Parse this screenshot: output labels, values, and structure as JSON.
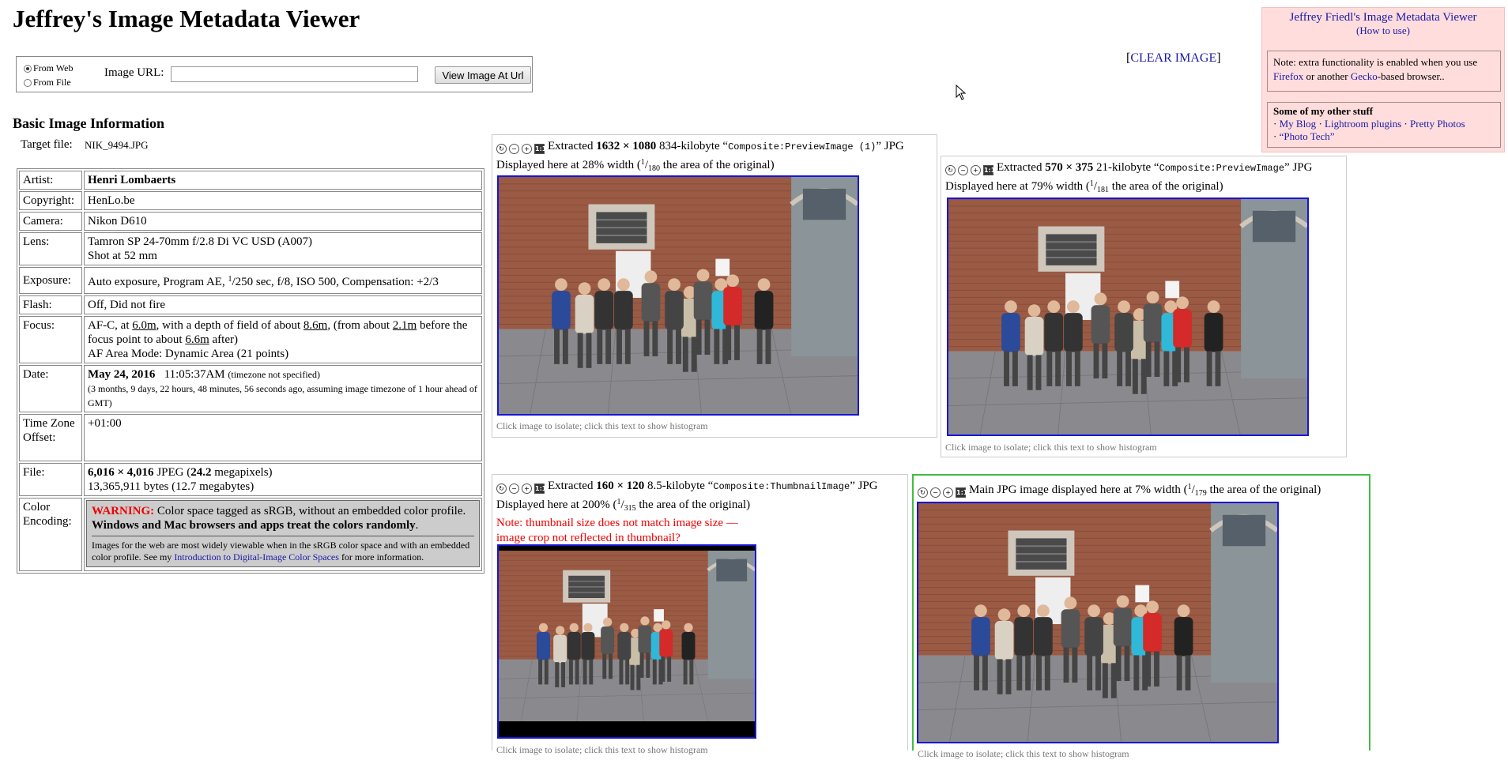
{
  "page": {
    "title": "Jeffrey's Image Metadata Viewer"
  },
  "form": {
    "from_web_label": "From Web",
    "from_file_label": "From File",
    "url_label": "Image URL:",
    "url_value": "",
    "view_button": "View Image At Url"
  },
  "clear": {
    "open": "[",
    "link": "CLEAR IMAGE",
    "close": "]"
  },
  "side": {
    "title": "Jeffrey Friedl's Image Metadata Viewer",
    "how_to_use": "(How to use)",
    "note_prefix": "Note: extra functionality is enabled when you use",
    "firefox": "Firefox",
    "note_mid": "or another",
    "gecko": "Gecko",
    "note_suffix": "-based browser..",
    "other_title": "Some of my other stuff",
    "links": [
      "My Blog",
      "Lightroom plugins",
      "Pretty Photos",
      "“Photo Tech”"
    ],
    "sep": "·"
  },
  "basic": {
    "heading": "Basic Image Information",
    "target_label": "Target file:",
    "target_value": "NIK_9494.JPG"
  },
  "info": {
    "artist_k": "Artist:",
    "artist_v": "Henri Lombaerts",
    "copyright_k": "Copyright:",
    "copyright_v": "HenLo.be",
    "camera_k": "Camera:",
    "camera_v": "Nikon D610",
    "lens_k": "Lens:",
    "lens_v1": "Tamron SP 24-70mm f/2.8 Di VC USD (A007)",
    "lens_v2": "Shot at 52 mm",
    "exposure_k": "Exposure:",
    "exposure_a": "Auto exposure, Program AE, ",
    "exposure_sup": "1",
    "exposure_b": "/250 sec, f/8, ISO 500, Compensation: +2/3",
    "flash_k": "Flash:",
    "flash_v": "Off, Did not fire",
    "focus_k": "Focus:",
    "focus_a": "AF-C, at ",
    "focus_d1": "6.0m",
    "focus_b": ", with a depth of field of about ",
    "focus_d2": "8.6m",
    "focus_c": ", (from about ",
    "focus_d3": "2.1m",
    "focus_e": " before the focus point to about ",
    "focus_d4": "6.6m",
    "focus_f": " after)",
    "focus_mode": "AF Area Mode: Dynamic Area (21 points)",
    "date_k": "Date:",
    "date_day": "May 24, 2016",
    "date_time": "11:05:37AM",
    "date_tz": "(timezone not specified)",
    "date_ago": "(3 months, 9 days, 22 hours, 48 minutes, 56 seconds ago, assuming image timezone of 1 hour ahead of GMT)",
    "tz_k": "Time Zone Offset:",
    "tz_v": "+01:00",
    "file_k": "File:",
    "file_dims": "6,016 × 4,016",
    "file_type": " JPEG (",
    "file_mp": "24.2",
    "file_mp_unit": " megapixels)",
    "file_bytes": "13,365,911 bytes (12.7 megabytes)",
    "color_k": "Color Encoding:",
    "warn_label": "WARNING:",
    "warn_a": " Color space tagged as sRGB, without an embedded color profile. ",
    "warn_bold": "Windows and Mac browsers and apps treat the colors randomly",
    "warn_end": ".",
    "fine_a": "Images for the web are most widely viewable when in the sRGB color space and with an embedded color profile. See my ",
    "fine_link": "Introduction to Digital-Image Color Spaces",
    "fine_b": " for more information."
  },
  "panels": [
    {
      "pre": "Extracted ",
      "dims": "1632 × 1080",
      "size": " 834-kilobyte “",
      "tag": "Composite:PreviewImage (1)",
      "post": "” JPG",
      "disp_a": "Displayed here at 28% width (",
      "frac_num": "1",
      "frac_den": "180",
      "disp_b": " the area of the original)",
      "caption": "Click image to isolate; click this text to show histogram"
    },
    {
      "pre": "Extracted ",
      "dims": "570 × 375",
      "size": " 21-kilobyte “",
      "tag": "Composite:PreviewImage",
      "post": "” JPG",
      "disp_a": "Displayed here at 79% width (",
      "frac_num": "1",
      "frac_den": "181",
      "disp_b": " the area of the original)",
      "caption": "Click image to isolate; click this text to show histogram"
    },
    {
      "pre": "Extracted ",
      "dims": "160 × 120",
      "size": " 8.5-kilobyte “",
      "tag": "Composite:ThumbnailImage",
      "post": "” JPG",
      "disp_a": "Displayed here at 200% (",
      "frac_num": "1",
      "frac_den": "315",
      "disp_b": " the area of the original)",
      "note": "Note: thumbnail size does not match image size — image crop not reflected in thumbnail?",
      "caption": "Click image to isolate; click this text to show histogram"
    },
    {
      "main": "Main JPG image displayed here at 7% width (",
      "frac_num": "1",
      "frac_den": "179",
      "disp_b": " the area of the original)",
      "caption": "Click image to isolate; click this text to show histogram"
    }
  ],
  "icons": {
    "rotate": "rotate-icon",
    "zoom_out": "zoom-out-icon",
    "zoom_in": "zoom-in-icon",
    "actual_size": "1:1"
  },
  "colors": {
    "link": "#1a1aa6",
    "warning": "#e00000",
    "photo_border": "#1515d8",
    "main_border": "#44bb44",
    "side_bg": "#ffdddd"
  }
}
